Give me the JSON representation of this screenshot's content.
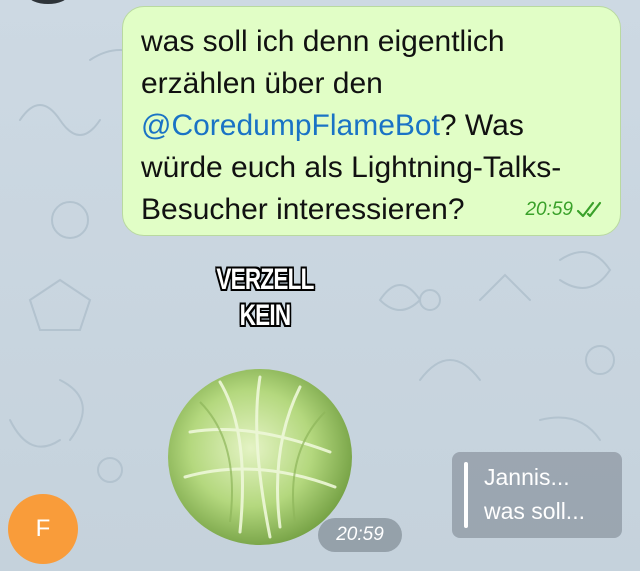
{
  "message_out": {
    "text_before_mention": "was soll ich denn eigentlich erzählen über den ",
    "mention": "@CoredumpFlameBot",
    "text_after_mention": "? Was würde euch als Lightning-Talks-Besucher interessieren?",
    "time": "20:59",
    "status_icon": "double-check-read-icon"
  },
  "sticker": {
    "caption_line1": "VERZELL",
    "caption_line2": "KEIN",
    "image_icon": "cabbage-icon",
    "time": "20:59"
  },
  "reply_preview": {
    "line1": "Jannis...",
    "line2": "was soll..."
  },
  "avatar": {
    "initial": "F",
    "color": "#f99c3a"
  },
  "colors": {
    "bubble_out": "#e1fec6",
    "mention": "#1a73c5",
    "time_out": "#3aa12a",
    "chat_background": "#ccd8e2"
  }
}
